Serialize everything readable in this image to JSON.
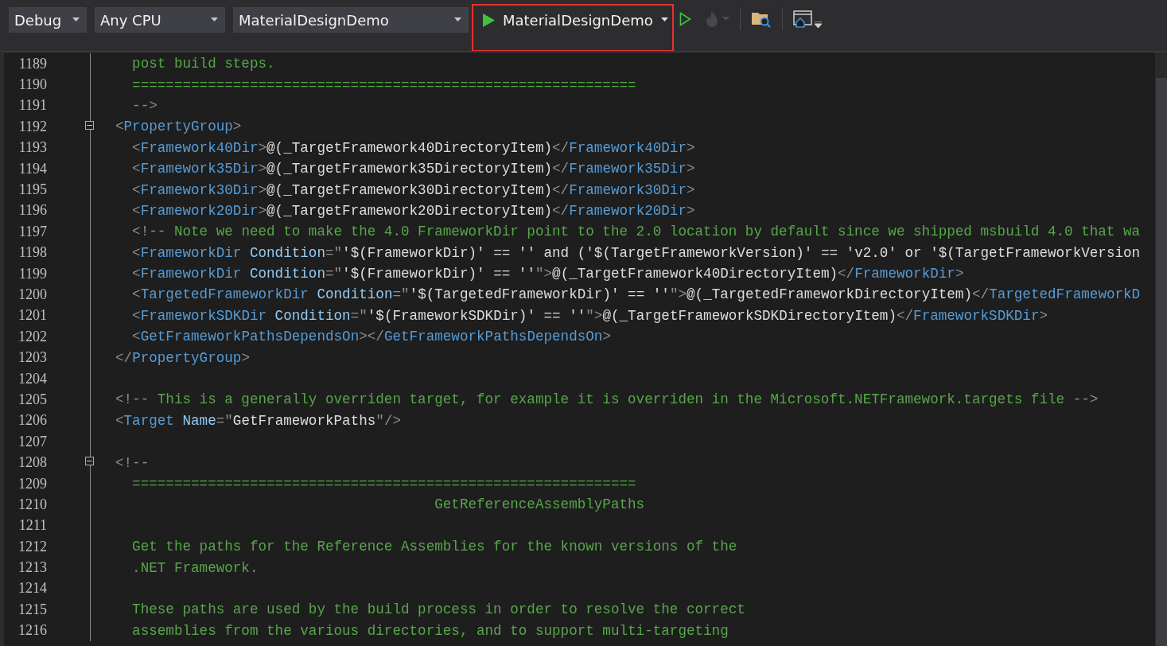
{
  "toolbar": {
    "dropdowns": [
      {
        "value": "Debug"
      },
      {
        "value": "Any CPU"
      },
      {
        "value": "MaterialDesignDemo"
      }
    ],
    "start_button": {
      "label": "MaterialDesignDemo",
      "highlighted": true
    },
    "hot_reload": {
      "disabled": true
    }
  },
  "editor": {
    "lines": [
      {
        "number": "1189",
        "tokens": [
          {
            "kind": "comment",
            "text": "  post build steps."
          }
        ]
      },
      {
        "number": "1190",
        "tokens": [
          {
            "kind": "comment",
            "text": "  ============================================================"
          }
        ]
      },
      {
        "number": "1191",
        "tokens": [
          {
            "kind": "punct",
            "text": "  -->"
          }
        ]
      },
      {
        "number": "1192",
        "fold": {
          "expanded": true
        },
        "tokens": [
          {
            "kind": "punct",
            "text": "<"
          },
          {
            "kind": "tag",
            "text": "PropertyGroup"
          },
          {
            "kind": "punct",
            "text": ">"
          }
        ]
      },
      {
        "number": "1193",
        "tokens": [
          {
            "kind": "punct",
            "text": "  <"
          },
          {
            "kind": "tag",
            "text": "Framework40Dir"
          },
          {
            "kind": "punct",
            "text": ">"
          },
          {
            "kind": "text",
            "text": "@(_TargetFramework40DirectoryItem)"
          },
          {
            "kind": "punct",
            "text": "</"
          },
          {
            "kind": "tag",
            "text": "Framework40Dir"
          },
          {
            "kind": "punct",
            "text": ">"
          }
        ]
      },
      {
        "number": "1194",
        "tokens": [
          {
            "kind": "punct",
            "text": "  <"
          },
          {
            "kind": "tag",
            "text": "Framework35Dir"
          },
          {
            "kind": "punct",
            "text": ">"
          },
          {
            "kind": "text",
            "text": "@(_TargetFramework35DirectoryItem)"
          },
          {
            "kind": "punct",
            "text": "</"
          },
          {
            "kind": "tag",
            "text": "Framework35Dir"
          },
          {
            "kind": "punct",
            "text": ">"
          }
        ]
      },
      {
        "number": "1195",
        "tokens": [
          {
            "kind": "punct",
            "text": "  <"
          },
          {
            "kind": "tag",
            "text": "Framework30Dir"
          },
          {
            "kind": "punct",
            "text": ">"
          },
          {
            "kind": "text",
            "text": "@(_TargetFramework30DirectoryItem)"
          },
          {
            "kind": "punct",
            "text": "</"
          },
          {
            "kind": "tag",
            "text": "Framework30Dir"
          },
          {
            "kind": "punct",
            "text": ">"
          }
        ]
      },
      {
        "number": "1196",
        "tokens": [
          {
            "kind": "punct",
            "text": "  <"
          },
          {
            "kind": "tag",
            "text": "Framework20Dir"
          },
          {
            "kind": "punct",
            "text": ">"
          },
          {
            "kind": "text",
            "text": "@(_TargetFramework20DirectoryItem)"
          },
          {
            "kind": "punct",
            "text": "</"
          },
          {
            "kind": "tag",
            "text": "Framework20Dir"
          },
          {
            "kind": "punct",
            "text": ">"
          }
        ]
      },
      {
        "number": "1197",
        "tokens": [
          {
            "kind": "punct",
            "text": "  <!--"
          },
          {
            "kind": "comment",
            "text": " Note we need to make the 4.0 FrameworkDir point to the 2.0 location by default since we shipped msbuild 4.0 that wa"
          }
        ]
      },
      {
        "number": "1198",
        "tokens": [
          {
            "kind": "punct",
            "text": "  <"
          },
          {
            "kind": "tag",
            "text": "FrameworkDir"
          },
          {
            "kind": "attr",
            "text": " Condition"
          },
          {
            "kind": "punct",
            "text": "=\""
          },
          {
            "kind": "text",
            "text": "'$(FrameworkDir)' == '' and ('$(TargetFrameworkVersion)' == 'v2.0' or '$(TargetFrameworkVersion"
          }
        ]
      },
      {
        "number": "1199",
        "tokens": [
          {
            "kind": "punct",
            "text": "  <"
          },
          {
            "kind": "tag",
            "text": "FrameworkDir"
          },
          {
            "kind": "attr",
            "text": " Condition"
          },
          {
            "kind": "punct",
            "text": "=\""
          },
          {
            "kind": "text",
            "text": "'$(FrameworkDir)' == ''"
          },
          {
            "kind": "punct",
            "text": "\">"
          },
          {
            "kind": "text",
            "text": "@(_TargetFramework40DirectoryItem)"
          },
          {
            "kind": "punct",
            "text": "</"
          },
          {
            "kind": "tag",
            "text": "FrameworkDir"
          },
          {
            "kind": "punct",
            "text": ">"
          }
        ]
      },
      {
        "number": "1200",
        "tokens": [
          {
            "kind": "punct",
            "text": "  <"
          },
          {
            "kind": "tag",
            "text": "TargetedFrameworkDir"
          },
          {
            "kind": "attr",
            "text": " Condition"
          },
          {
            "kind": "punct",
            "text": "=\""
          },
          {
            "kind": "text",
            "text": "'$(TargetedFrameworkDir)' == ''"
          },
          {
            "kind": "punct",
            "text": "\">"
          },
          {
            "kind": "text",
            "text": "@(_TargetedFrameworkDirectoryItem)"
          },
          {
            "kind": "punct",
            "text": "</"
          },
          {
            "kind": "tag",
            "text": "TargetedFrameworkD"
          }
        ]
      },
      {
        "number": "1201",
        "tokens": [
          {
            "kind": "punct",
            "text": "  <"
          },
          {
            "kind": "tag",
            "text": "FrameworkSDKDir"
          },
          {
            "kind": "attr",
            "text": " Condition"
          },
          {
            "kind": "punct",
            "text": "=\""
          },
          {
            "kind": "text",
            "text": "'$(FrameworkSDKDir)' == ''"
          },
          {
            "kind": "punct",
            "text": "\">"
          },
          {
            "kind": "text",
            "text": "@(_TargetFrameworkSDKDirectoryItem)"
          },
          {
            "kind": "punct",
            "text": "</"
          },
          {
            "kind": "tag",
            "text": "FrameworkSDKDir"
          },
          {
            "kind": "punct",
            "text": ">"
          }
        ]
      },
      {
        "number": "1202",
        "tokens": [
          {
            "kind": "punct",
            "text": "  <"
          },
          {
            "kind": "tag",
            "text": "GetFrameworkPathsDependsOn"
          },
          {
            "kind": "punct",
            "text": "></"
          },
          {
            "kind": "tag",
            "text": "GetFrameworkPathsDependsOn"
          },
          {
            "kind": "punct",
            "text": ">"
          }
        ]
      },
      {
        "number": "1203",
        "tokens": [
          {
            "kind": "punct",
            "text": "</"
          },
          {
            "kind": "tag",
            "text": "PropertyGroup"
          },
          {
            "kind": "punct",
            "text": ">"
          }
        ]
      },
      {
        "number": "1204"
      },
      {
        "number": "1205",
        "tokens": [
          {
            "kind": "punct",
            "text": "<!--"
          },
          {
            "kind": "comment",
            "text": " This is a generally overriden target, for example it is overriden in the Microsoft.NETFramework.targets file "
          },
          {
            "kind": "punct",
            "text": "-->"
          }
        ]
      },
      {
        "number": "1206",
        "tokens": [
          {
            "kind": "punct",
            "text": "<"
          },
          {
            "kind": "tag",
            "text": "Target"
          },
          {
            "kind": "attr",
            "text": " Name"
          },
          {
            "kind": "punct",
            "text": "=\""
          },
          {
            "kind": "text",
            "text": "GetFrameworkPaths"
          },
          {
            "kind": "punct",
            "text": "\"/>"
          }
        ]
      },
      {
        "number": "1207"
      },
      {
        "number": "1208",
        "fold": {
          "expanded": true
        },
        "tokens": [
          {
            "kind": "punct",
            "text": "<!--"
          }
        ]
      },
      {
        "number": "1209",
        "tokens": [
          {
            "kind": "comment",
            "text": "  ============================================================"
          }
        ]
      },
      {
        "number": "1210",
        "tokens": [
          {
            "kind": "comment",
            "text": "                                      GetReferenceAssemblyPaths"
          }
        ]
      },
      {
        "number": "1211"
      },
      {
        "number": "1212",
        "tokens": [
          {
            "kind": "comment",
            "text": "  Get the paths for the Reference Assemblies for the known versions of the"
          }
        ]
      },
      {
        "number": "1213",
        "tokens": [
          {
            "kind": "comment",
            "text": "  .NET Framework."
          }
        ]
      },
      {
        "number": "1214"
      },
      {
        "number": "1215",
        "tokens": [
          {
            "kind": "comment",
            "text": "  These paths are used by the build process in order to resolve the correct"
          }
        ]
      },
      {
        "number": "1216",
        "tokens": [
          {
            "kind": "comment",
            "text": "  assemblies from the various directories, and to support multi-targeting"
          }
        ]
      }
    ]
  }
}
